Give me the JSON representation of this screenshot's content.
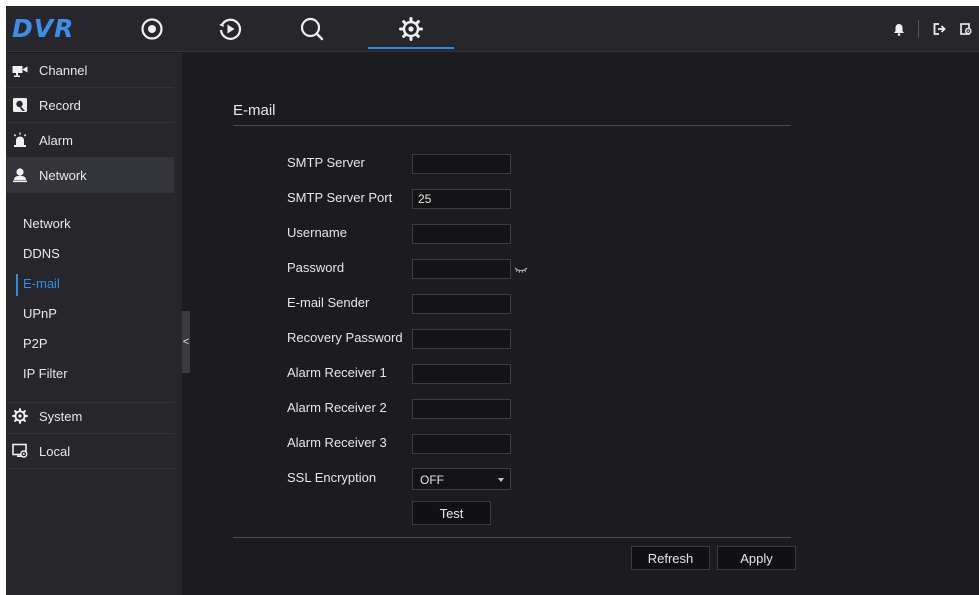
{
  "app": {
    "logo": "DVR",
    "accent_color": "#2f86de"
  },
  "topnav": {
    "items": [
      {
        "icon": "live-view-icon"
      },
      {
        "icon": "playback-icon"
      },
      {
        "icon": "search-icon"
      },
      {
        "icon": "settings-gear-icon",
        "active": true
      }
    ],
    "right_icons": [
      "bell-icon",
      "logout-icon",
      "lock-screen-icon"
    ]
  },
  "sidebar": {
    "menu": [
      {
        "label": "Channel",
        "icon": "camera-icon"
      },
      {
        "label": "Record",
        "icon": "record-icon"
      },
      {
        "label": "Alarm",
        "icon": "alarm-icon"
      },
      {
        "label": "Network",
        "icon": "network-user-icon",
        "active": true
      },
      {
        "label": "System",
        "icon": "system-gear-icon"
      },
      {
        "label": "Local",
        "icon": "monitor-icon"
      }
    ],
    "network_sub": [
      "Network",
      "DDNS",
      "E-mail",
      "UPnP",
      "P2P",
      "IP Filter"
    ],
    "active_sub": "E-mail",
    "collapse_glyph": "<"
  },
  "page": {
    "title": "E-mail",
    "fields": [
      {
        "label": "SMTP Server",
        "value": ""
      },
      {
        "label": "SMTP Server Port",
        "value": "25"
      },
      {
        "label": "Username",
        "value": ""
      },
      {
        "label": "Password",
        "value": ""
      },
      {
        "label": "E-mail Sender",
        "value": ""
      },
      {
        "label": "Recovery Password",
        "value": ""
      },
      {
        "label": "Alarm Receiver 1",
        "value": ""
      },
      {
        "label": "Alarm Receiver 2",
        "value": ""
      },
      {
        "label": "Alarm Receiver 3",
        "value": ""
      }
    ],
    "ssl": {
      "label": "SSL Encryption",
      "value": "OFF"
    },
    "test_label": "Test",
    "refresh_label": "Refresh",
    "apply_label": "Apply"
  }
}
